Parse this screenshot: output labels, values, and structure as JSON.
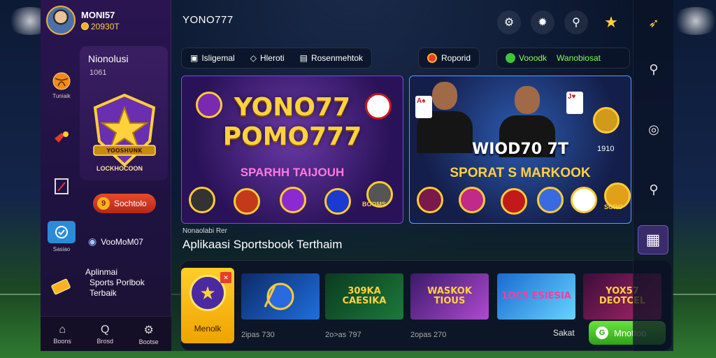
{
  "profile": {
    "name": "MONI57",
    "coins": "20930T"
  },
  "sidebar": {
    "menu_title": "Nionolusi",
    "menu_sub": "1061",
    "badge_text": "LOCKHOCOON",
    "badge_banner": "YOOSHUNK",
    "side_items": [
      {
        "icon": "basketball-icon",
        "label": "Tuniaik"
      },
      {
        "icon": "whistle-icon",
        "label": ""
      },
      {
        "icon": "clipboard-icon",
        "label": ""
      },
      {
        "icon": "chat-icon",
        "label": "Sasiao"
      },
      {
        "icon": "ticket-icon",
        "label": ""
      }
    ],
    "orange_button": {
      "badge": "9",
      "label": "Sochtolo"
    },
    "promo_name": "VooMoM07",
    "promo_desc_lines": [
      "Aplinmai",
      "Sports Porlbok",
      "Terbaik"
    ],
    "bottom_nav": [
      {
        "icon": "home-icon",
        "label": "Boons"
      },
      {
        "icon": "search-icon",
        "label": "Brosd"
      },
      {
        "icon": "gear-icon",
        "label": "Bootse"
      }
    ]
  },
  "header": {
    "title": "YONO777",
    "tabs_left": [
      "Isligemal",
      "Hleroti",
      "Rosenmehtok"
    ],
    "promo_tab": "Roporid",
    "green_tabs": [
      "Vooodk",
      "Wanobiosat"
    ]
  },
  "banners": [
    {
      "title_line1": "YONO77",
      "title_line2": "POMO777",
      "subtitle": "SPARHH TAIJOUH",
      "chip_label": "BOOMS"
    },
    {
      "title_line1": "WIOD70 7T",
      "subtitle": "SPORAT S MARKOOK",
      "score": "1910",
      "chip_label": "SORO"
    }
  ],
  "caption": {
    "small": "Nonaolabi Rer",
    "big": "Aplikaasi Sportsbook Terthaim"
  },
  "games": {
    "featured_label": "Menolk",
    "cards": [
      {
        "title": "",
        "caption": "2ipas 730",
        "colors": [
          "#0d2a66",
          "#1f6fe0"
        ]
      },
      {
        "title": "309KA CAESIKA",
        "caption": "2o>as 797",
        "colors": [
          "#0b3a20",
          "#1c7a3a"
        ]
      },
      {
        "title": "WASKOK TIOUS",
        "caption": "2opas 270",
        "colors": [
          "#3a1a6a",
          "#b04ad0"
        ]
      },
      {
        "title": "1OC5 ESIESIA",
        "caption": "",
        "colors": [
          "#1a6ad0",
          "#66d4ff"
        ]
      },
      {
        "title": "YOX57 DEOTCEL",
        "caption": "",
        "colors": [
          "#3a0e3a",
          "#b0246a"
        ]
      }
    ],
    "sakat_label": "Sakat",
    "green_button": "Mnotloo"
  },
  "colors": {
    "accent_gold": "#ffd23d",
    "accent_green": "#39c936",
    "accent_red": "#e2402a",
    "panel_purple": "#2a1550"
  }
}
